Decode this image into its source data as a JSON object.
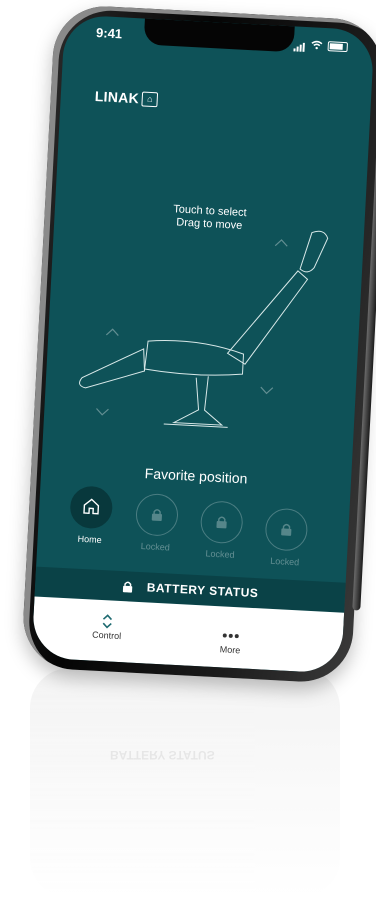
{
  "status": {
    "time": "9:41"
  },
  "brand": {
    "name": "LINAK",
    "mark": "⌂"
  },
  "hint": {
    "line1": "Touch to select",
    "line2": "Drag to move"
  },
  "favorites": {
    "title": "Favorite position",
    "items": [
      {
        "label": "Home",
        "state": "active",
        "icon": "home-icon"
      },
      {
        "label": "Locked",
        "state": "locked",
        "icon": "lock-icon"
      },
      {
        "label": "Locked",
        "state": "locked",
        "icon": "lock-icon"
      },
      {
        "label": "Locked",
        "state": "locked",
        "icon": "lock-icon"
      }
    ]
  },
  "battery": {
    "label": "BATTERY STATUS",
    "icon": "lock-icon"
  },
  "tabs": [
    {
      "label": "Control",
      "icon": "chevron-updown-icon"
    },
    {
      "label": "More",
      "icon": "more-dots-icon"
    }
  ],
  "colors": {
    "screen": "#0e5258",
    "dark": "#0a4247",
    "accent": "#1d6a70"
  }
}
